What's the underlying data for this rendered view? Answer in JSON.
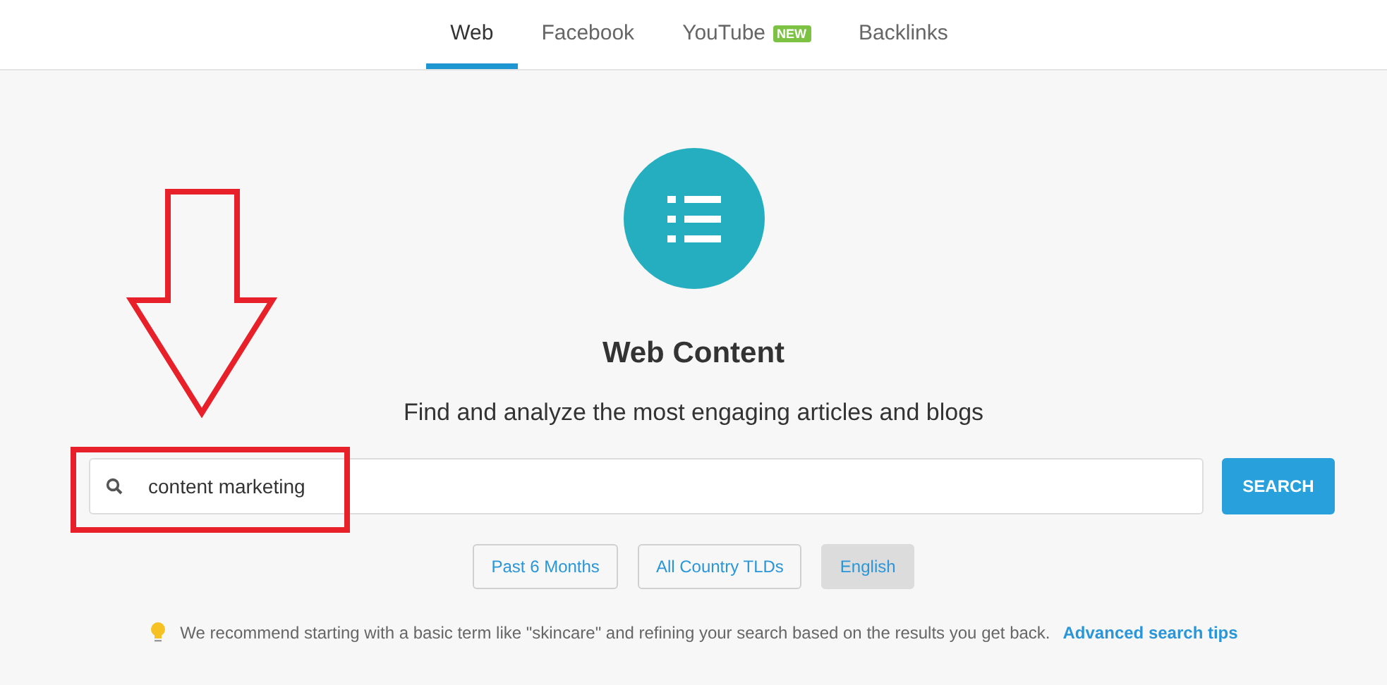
{
  "tabs": [
    {
      "label": "Web",
      "selected": true
    },
    {
      "label": "Facebook",
      "selected": false
    },
    {
      "label": "YouTube",
      "selected": false,
      "badge": "NEW"
    },
    {
      "label": "Backlinks",
      "selected": false
    }
  ],
  "hero": {
    "title": "Web Content",
    "subtitle": "Find and analyze the most engaging articles and blogs"
  },
  "search": {
    "value": "content marketing",
    "button": "SEARCH"
  },
  "filters": [
    {
      "label": "Past 6 Months",
      "selected": false
    },
    {
      "label": "All Country TLDs",
      "selected": false
    },
    {
      "label": "English",
      "selected": true
    }
  ],
  "tip": {
    "text": "We recommend starting with a basic term like \"skincare\" and refining your search based on the results you get back.",
    "link": "Advanced search tips"
  }
}
